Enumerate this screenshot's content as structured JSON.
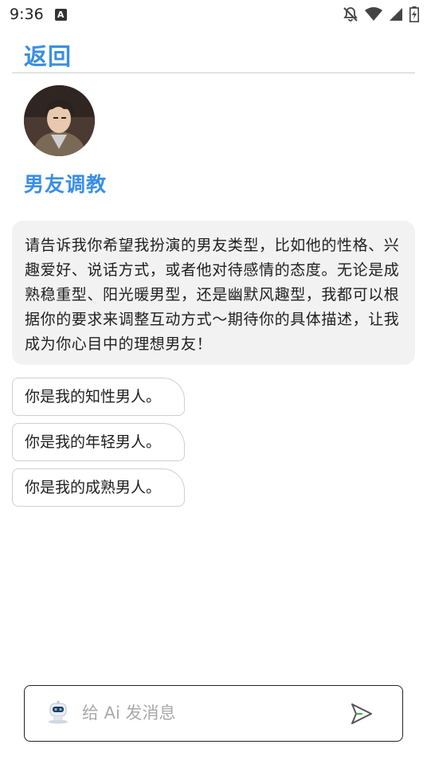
{
  "statusbar": {
    "time": "9:36",
    "notification_icon_letter": "A"
  },
  "header": {
    "back_label": "返回"
  },
  "bot": {
    "name": "男友调教"
  },
  "message": {
    "text": "请告诉我你希望我扮演的男友类型，比如他的性格、兴趣爱好、说话方式，或者他对待感情的态度。无论是成熟稳重型、阳光暖男型，还是幽默风趣型，我都可以根据你的要求来调整互动方式～期待你的具体描述，让我成为你心目中的理想男友！"
  },
  "suggestions": [
    {
      "label": "你是我的知性男人。"
    },
    {
      "label": "你是我的年轻男人。"
    },
    {
      "label": "你是我的成熟男人。"
    }
  ],
  "input": {
    "placeholder": "给 Ai 发消息",
    "value": ""
  },
  "colors": {
    "accent": "#3a8ee6",
    "bubble_bg": "#f2f2f3",
    "border": "#cfcfcf"
  }
}
